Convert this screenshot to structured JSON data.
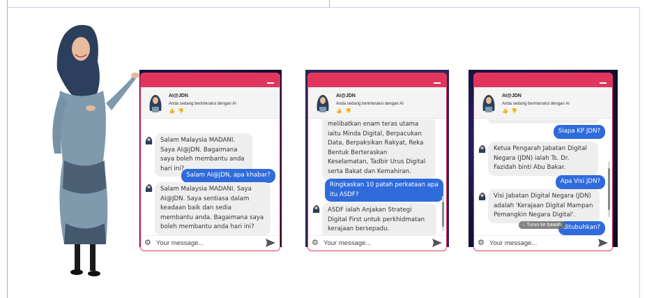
{
  "widgets": [
    {
      "name": "AI@JDN",
      "subtitle": "Anda sedang berinteraksi dengan AI",
      "thumbs": "👍 👎",
      "placeholder": "Your message...",
      "messages": [
        {
          "role": "bot",
          "text": "Salam Malaysia MADANI. Saya AI@JDN. Bagaimana saya boleh membantu anda hari ini?"
        },
        {
          "role": "user",
          "text": "Salam AI@JDN, apa khabar?"
        },
        {
          "role": "bot",
          "text": "Salam Malaysia MADANI. Saya AI@JDN. Saya sentiasa dalam keadaan baik dan sedia membantu anda. Bagaimana saya boleh membantu anda hari ini?"
        }
      ]
    },
    {
      "name": "AI@JDN",
      "subtitle": "Anda sedang berinteraksi dengan AI",
      "thumbs": "👍 👎",
      "placeholder": "Your message...",
      "messages": [
        {
          "role": "bot",
          "text": "melibatkan enam teras utama iaitu Minda Digital, Berpacukan Data, Berpaksikan Rakyat, Reka Bentuk Berteraskan Keselamatan, Tadbir Urus Digital serta Bakat dan Kemahiran."
        },
        {
          "role": "user",
          "text": "Ringkaskan 10 patah perkataan apa itu ASDF?"
        },
        {
          "role": "bot",
          "text": "ASDF ialah Anjakan Strategi Digital First untuk perkhidmatan kerajaan bersepadu."
        }
      ]
    },
    {
      "name": "AI@JDN",
      "subtitle": "Anda sedang berinteraksi dengan AI",
      "thumbs": "👍 👎",
      "placeholder": "Your message...",
      "messages": [
        {
          "role": "user",
          "text": "Siapa KP JDN?"
        },
        {
          "role": "bot",
          "text": "Ketua Pengarah Jabatan Digital Negara (JDN) ialah Ts. Dr. Fazidah binti Abu Bakar."
        },
        {
          "role": "user",
          "text": "Apa Visi JDN?"
        },
        {
          "role": "bot",
          "text": "Visi Jabatan Digital Negara (JDN) adalah 'Kerajaan Digital Mampan Pemangkin Negara Digital'."
        },
        {
          "role": "user",
          "text": "ditubuhkan?"
        }
      ],
      "scroll_down_label": "↓ Turun ke bawah"
    }
  ],
  "colors": {
    "accent": "#e0365d",
    "user_bubble": "#2f6bdb",
    "bot_bubble": "#eeeeee"
  },
  "icons": {
    "send": "send-icon",
    "settings": "gear-icon",
    "bot": "bot-avatar-icon"
  }
}
